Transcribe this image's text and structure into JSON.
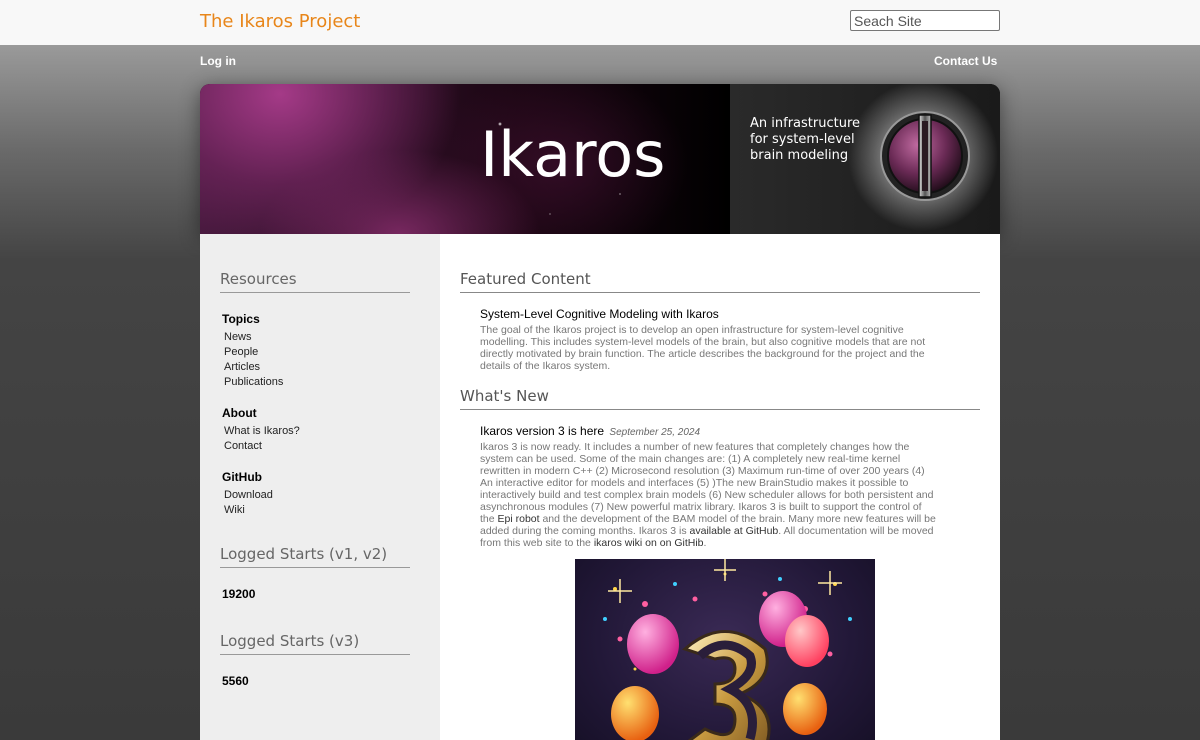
{
  "header": {
    "site_title": "The Ikaros Project",
    "search_placeholder": "Seach Site"
  },
  "nav": {
    "login": "Log in",
    "contact": "Contact Us"
  },
  "banner": {
    "title": "Ikaros",
    "tagline_lines": [
      "An infrastructure",
      "for system-level",
      "brain modeling"
    ]
  },
  "sidebar": {
    "resources_heading": "Resources",
    "topics": {
      "title": "Topics",
      "items": [
        "News",
        "People",
        "Articles",
        "Publications"
      ]
    },
    "about": {
      "title": "About",
      "items": [
        "What is Ikaros?",
        "Contact"
      ]
    },
    "github": {
      "title": "GitHub",
      "items": [
        "Download",
        "Wiki"
      ]
    },
    "logged_v1v2": {
      "heading": "Logged Starts (v1, v2)",
      "value": "19200"
    },
    "logged_v3": {
      "heading": "Logged Starts (v3)",
      "value": "5560"
    }
  },
  "main": {
    "featured_heading": "Featured Content",
    "featured_title": "System-Level Cognitive Modeling with Ikaros",
    "featured_lines": [
      "The goal of the Ikaros project is to develop an open infrastructure for system-level cognitive",
      "modelling. This includes system-level models of the brain, but also cognitive models that are not",
      "directly motivated by brain function. The article describes the background for the project and the",
      "details of the Ikaros system."
    ],
    "whatsnew_heading": "What's New",
    "news_title": "Ikaros version 3 is here",
    "news_date": "September 25, 2024",
    "news_lines": [
      "Ikaros 3 is now ready. It includes a number of new features that completely changes how the",
      "system can be used. Some of the main changes are: (1) A completely new real-time kernel",
      "rewritten in modern C++ (2) Microsecond resolution (3) Maximum run-time of over 200 years (4)",
      "An interactive editor for models and interfaces (5) )The new BrainStudio makes it possible to",
      "interactively build and test complex brain models (6) New scheduler allows for both persistent and",
      "asynchronous modules (7) New powerful matrix library. Ikaros 3 is built to support the control of"
    ],
    "news_line7_pre": "the ",
    "news_line7_link": "Epi robot",
    "news_line7_post": " and the development of the BAM model of the brain. Many more new features will be",
    "news_line8_pre": "added during the coming months. Ikaros 3 is ",
    "news_line8_link": "available at GitHub",
    "news_line8_post": ". All documentation will be moved",
    "news_line9_pre": "from this web site to the ",
    "news_line9_link": "ikaros wiki on on GitHib",
    "news_line9_post": "."
  },
  "colors": {
    "title_orange": "#e8861a",
    "sidebar_bg": "#eeeeee"
  }
}
